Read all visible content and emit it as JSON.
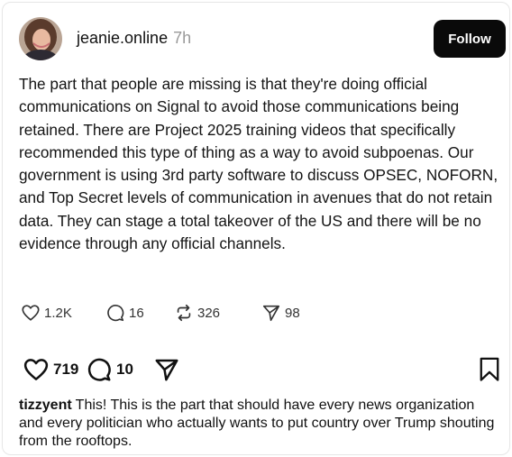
{
  "post": {
    "username": "jeanie.online",
    "time": "7h",
    "follow_label": "Follow",
    "text": "The part that people are missing is that they're doing official communications on Signal to avoid those communications being retained. There are Project 2025 training videos that specifically recommended this type of thing as a way to avoid subpoenas. Our government is using 3rd party software to discuss OPSEC, NOFORN, and Top Secret levels of communication in avenues that do not retain data. They can stage a total takeover of the US and there will be no evidence through any official channels.",
    "stats": {
      "likes": "1.2K",
      "replies": "16",
      "reposts": "326",
      "shares": "98"
    }
  },
  "actions": {
    "likes": "719",
    "comments": "10"
  },
  "comment": {
    "username": "tizzyent",
    "text": "This! This is the part that should have every news organization and every politician who actually wants to put country over Trump shouting from the rooftops."
  },
  "icons": {
    "like": "heart-icon",
    "reply": "speech-bubble-icon",
    "repost": "repost-icon",
    "share": "send-icon",
    "bookmark": "bookmark-icon"
  },
  "colors": {
    "follow_bg": "#0a0a0a",
    "muted": "#999999"
  }
}
